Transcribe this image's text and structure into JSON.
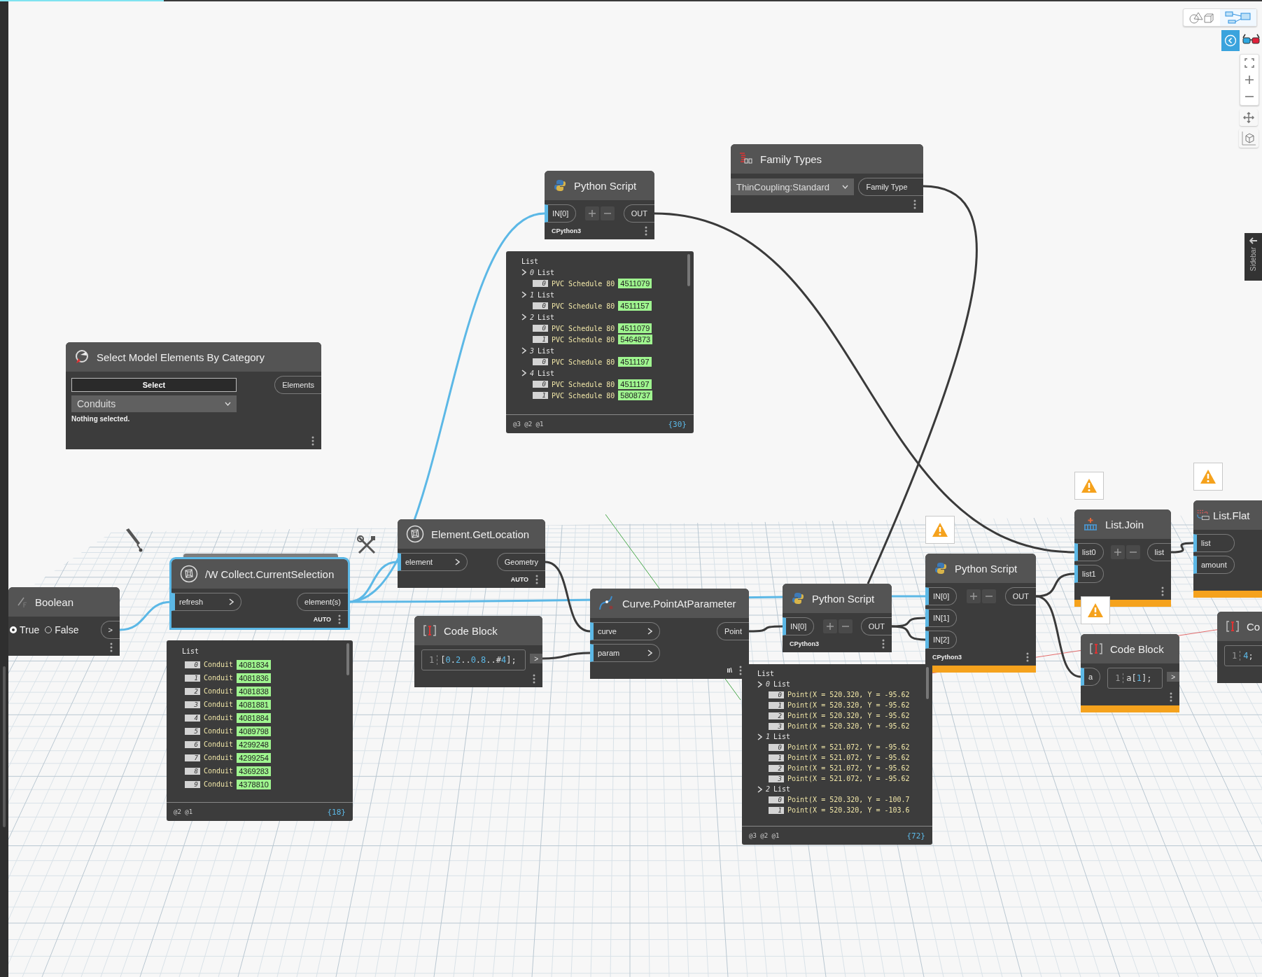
{
  "progress": {
    "level": 0.13
  },
  "canvas": {
    "nodes": [
      {
        "kind": "category_select",
        "title": "Select Model Elements By Category",
        "selected": false,
        "warning": false,
        "button": "Select",
        "dropdown": "Conduits",
        "status": "Nothing selected.",
        "outputs": [
          {
            "label": "Elements"
          }
        ]
      },
      {
        "kind": "python",
        "title": "Python Script",
        "selected": false,
        "warning": false,
        "inputs": [
          {
            "label": "IN[0]"
          }
        ],
        "outputs": [
          {
            "label": "OUT"
          }
        ],
        "footer": "CPython3",
        "preview": {
          "title": "List",
          "levels": "@3 @2 @1",
          "count": "{30}",
          "items": [
            {
              "index": "0",
              "label": "List",
              "children": [
                {
                  "index": "0",
                  "label": "PVC Schedule 80",
                  "value": "4511079"
                }
              ]
            },
            {
              "index": "1",
              "label": "List",
              "children": [
                {
                  "index": "0",
                  "label": "PVC Schedule 80",
                  "value": "4511157"
                }
              ]
            },
            {
              "index": "2",
              "label": "List",
              "children": [
                {
                  "index": "0",
                  "label": "PVC Schedule 80",
                  "value": "4511079"
                },
                {
                  "index": "1",
                  "label": "PVC Schedule 80",
                  "value": "5464873"
                }
              ]
            },
            {
              "index": "3",
              "label": "List",
              "children": [
                {
                  "index": "0",
                  "label": "PVC Schedule 80",
                  "value": "4511197"
                }
              ]
            },
            {
              "index": "4",
              "label": "List",
              "children": [
                {
                  "index": "0",
                  "label": "PVC Schedule 80",
                  "value": "4511197"
                },
                {
                  "index": "1",
                  "label": "PVC Schedule 80",
                  "value": "5808737"
                }
              ]
            }
          ]
        }
      },
      {
        "kind": "family_types",
        "title": "Family Types",
        "selected": false,
        "warning": false,
        "dropdown": "ThinCoupling:Standard",
        "outputs": [
          {
            "label": "Family Type"
          }
        ]
      },
      {
        "kind": "boolean",
        "title": "Boolean",
        "selected": false,
        "warning": false,
        "options": [
          {
            "label": "True",
            "selected": true
          },
          {
            "label": "False",
            "selected": false
          }
        ],
        "outputs": [
          {
            "label": ">"
          }
        ]
      },
      {
        "kind": "element",
        "title": "/W Collect.CurrentSelection",
        "selected": true,
        "warning": false,
        "inputs": [
          {
            "label": "refresh"
          }
        ],
        "outputs": [
          {
            "label": "element(s)"
          }
        ],
        "footer": "AUTO",
        "preview": {
          "title": "List",
          "levels": "@2 @1",
          "count": "{18}",
          "items": [
            {
              "index": "0",
              "label": "Conduit",
              "value": "4081834"
            },
            {
              "index": "1",
              "label": "Conduit",
              "value": "4081836"
            },
            {
              "index": "2",
              "label": "Conduit",
              "value": "4081838"
            },
            {
              "index": "3",
              "label": "Conduit",
              "value": "4081881"
            },
            {
              "index": "4",
              "label": "Conduit",
              "value": "4081884"
            },
            {
              "index": "5",
              "label": "Conduit",
              "value": "4089798"
            },
            {
              "index": "6",
              "label": "Conduit",
              "value": "4299248"
            },
            {
              "index": "7",
              "label": "Conduit",
              "value": "4299254"
            },
            {
              "index": "8",
              "label": "Conduit",
              "value": "4369283"
            },
            {
              "index": "9",
              "label": "Conduit",
              "value": "4378810"
            }
          ]
        }
      },
      {
        "kind": "element",
        "title": "Element.GetLocation",
        "selected": false,
        "warning": false,
        "inputs": [
          {
            "label": "element"
          }
        ],
        "outputs": [
          {
            "label": "Geometry"
          }
        ],
        "footer": "AUTO"
      },
      {
        "kind": "code_block",
        "title": "Code Block",
        "selected": false,
        "warning": false,
        "code": [
          {
            "line": "1",
            "text": "[0.2..0.8..#4];"
          }
        ],
        "outputs": [
          {
            "label": ">"
          }
        ]
      },
      {
        "kind": "curve",
        "title": "Curve.PointAtParameter",
        "selected": false,
        "warning": false,
        "inputs": [
          {
            "label": "curve"
          },
          {
            "label": "param"
          }
        ],
        "outputs": [
          {
            "label": "Point"
          }
        ],
        "footer": "II\\"
      },
      {
        "kind": "python",
        "title": "Python Script",
        "selected": false,
        "warning": false,
        "inputs": [
          {
            "label": "IN[0]"
          }
        ],
        "outputs": [
          {
            "label": "OUT"
          }
        ],
        "footer": "CPython3",
        "preview": {
          "title": "List",
          "levels": "@3 @2 @1",
          "count": "{72}",
          "items": [
            {
              "index": "0",
              "label": "List",
              "children": [
                {
                  "index": "0",
                  "label": "Point(X = 520.320, Y = -95.62"
                },
                {
                  "index": "1",
                  "label": "Point(X = 520.320, Y = -95.62"
                },
                {
                  "index": "2",
                  "label": "Point(X = 520.320, Y = -95.62"
                },
                {
                  "index": "3",
                  "label": "Point(X = 520.320, Y = -95.62"
                }
              ]
            },
            {
              "index": "1",
              "label": "List",
              "children": [
                {
                  "index": "0",
                  "label": "Point(X = 521.072, Y = -95.62"
                },
                {
                  "index": "1",
                  "label": "Point(X = 521.072, Y = -95.62"
                },
                {
                  "index": "2",
                  "label": "Point(X = 521.072, Y = -95.62"
                },
                {
                  "index": "3",
                  "label": "Point(X = 521.072, Y = -95.62"
                }
              ]
            },
            {
              "index": "2",
              "label": "List",
              "children": [
                {
                  "index": "0",
                  "label": "Point(X = 520.320, Y = -100.7"
                },
                {
                  "index": "1",
                  "label": "Point(X = 520.320, Y = -103.6"
                }
              ]
            }
          ]
        }
      },
      {
        "kind": "python",
        "title": "Python Script",
        "selected": false,
        "warning": true,
        "inputs": [
          {
            "label": "IN[0]"
          },
          {
            "label": "IN[1]"
          },
          {
            "label": "IN[2]"
          }
        ],
        "outputs": [
          {
            "label": "OUT"
          }
        ],
        "footer": "CPython3"
      },
      {
        "kind": "list_join",
        "title": "List.Join",
        "selected": false,
        "warning": true,
        "inputs": [
          {
            "label": "list0"
          },
          {
            "label": "list1"
          }
        ],
        "outputs": [
          {
            "label": "list"
          }
        ]
      },
      {
        "kind": "code_block",
        "title": "Code Block",
        "selected": false,
        "warning": true,
        "inputs": [
          {
            "label": "a"
          }
        ],
        "code": [
          {
            "line": "1",
            "text": "a[1];"
          }
        ],
        "outputs": [
          {
            "label": ">"
          }
        ]
      },
      {
        "kind": "list_flatten",
        "title": "List.Flat",
        "selected": false,
        "warning": true,
        "inputs": [
          {
            "label": "list"
          },
          {
            "label": "amount"
          }
        ]
      },
      {
        "kind": "code_block",
        "title": "Co",
        "selected": false,
        "warning": false,
        "code": [
          {
            "line": "1",
            "text": "4;"
          }
        ]
      }
    ]
  },
  "view_modes": [
    {
      "kind": "geometry",
      "selected": false
    },
    {
      "kind": "graph",
      "selected": true
    }
  ],
  "sidebar_tab": {
    "label": "Sidebar"
  }
}
